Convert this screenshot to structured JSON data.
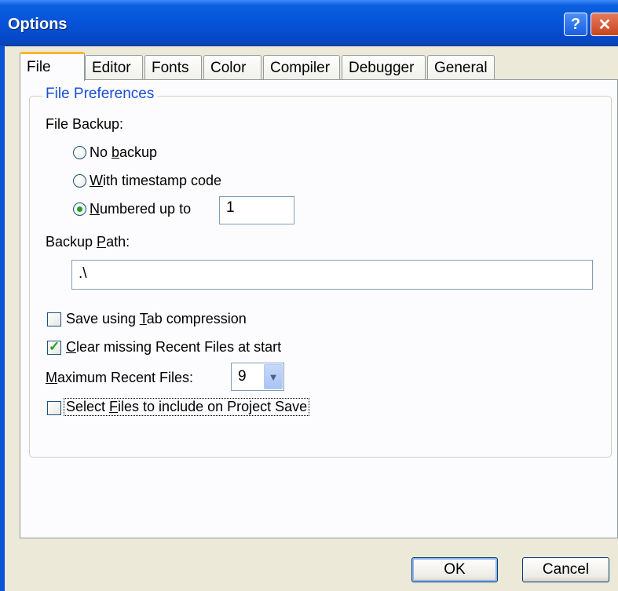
{
  "window": {
    "title": "Options",
    "help_glyph": "?",
    "close_glyph": "✕"
  },
  "tabs": [
    "File",
    "Editor",
    "Fonts",
    "Color",
    "Compiler",
    "Debugger",
    "General"
  ],
  "active_tab": "File",
  "file_preferences": {
    "legend": "File Preferences",
    "file_backup_label": "File Backup:",
    "backup_options": [
      {
        "prefix": "No ",
        "accel": "b",
        "rest": "ackup",
        "selected": false
      },
      {
        "prefix": "",
        "accel": "W",
        "rest": "ith timestamp code",
        "selected": false
      },
      {
        "prefix": "",
        "accel": "N",
        "rest": "umbered up to",
        "selected": true
      }
    ],
    "numbered_value": "1",
    "backup_path_label": {
      "prefix": "Backup ",
      "accel": "P",
      "rest": "ath:"
    },
    "backup_path_value": ".\\",
    "tab_compression": {
      "prefix": "Save using ",
      "accel": "T",
      "rest": "ab compression",
      "checked": false
    },
    "clear_missing": {
      "prefix": "",
      "accel": "C",
      "rest": "lear missing Recent Files at start",
      "checked": true
    },
    "max_recent_label": {
      "prefix": "",
      "accel": "M",
      "rest": "aximum Recent Files:"
    },
    "max_recent_value": "9",
    "select_files": {
      "prefix": "Select ",
      "accel": "F",
      "rest": "iles to include on Project Save",
      "checked": false
    }
  },
  "buttons": {
    "ok": "OK",
    "cancel": "Cancel"
  },
  "icons": {
    "check_mark": "✓",
    "dropdown_arrow": "▼"
  },
  "colors": {
    "titlebar": "#0653d8",
    "legend": "#1a4fd6",
    "tab_highlight": "#f7b530",
    "check_green": "#21a121"
  }
}
